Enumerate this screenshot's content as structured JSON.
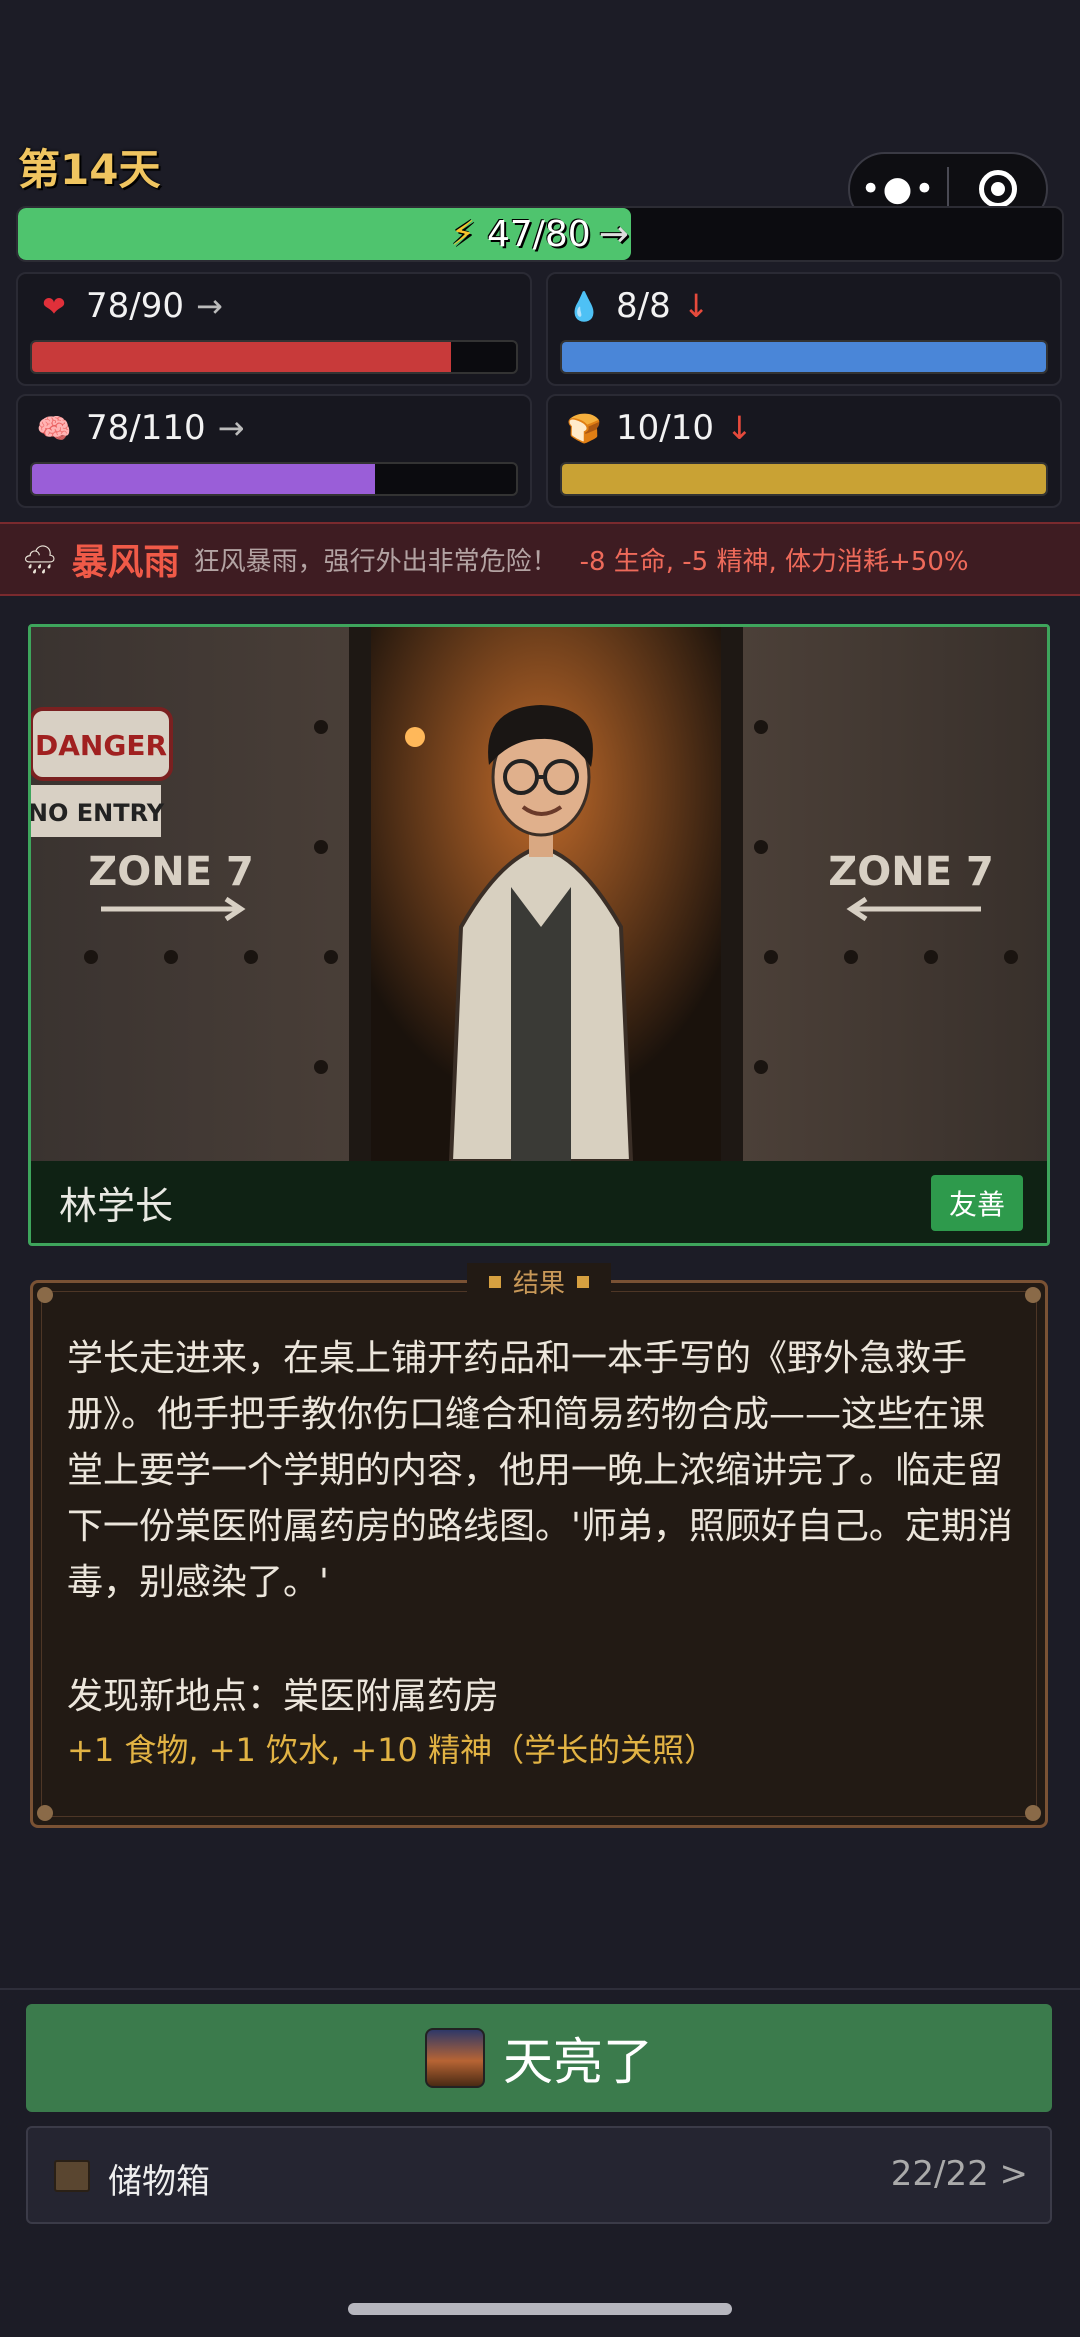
{
  "day_label": "第14天",
  "stamina": {
    "text": "47/80",
    "current": 47,
    "max": 80,
    "trend": "→",
    "icon": "lightning-icon",
    "color": "#4fc46e"
  },
  "stats": [
    {
      "key": "health",
      "icon": "heart-icon",
      "glyph": "❤",
      "text": "78/90",
      "current": 78,
      "max": 90,
      "trend": "→",
      "trend_kind": "steady",
      "color": "#c83a3a"
    },
    {
      "key": "water",
      "icon": "water-drop-icon",
      "glyph": "💧",
      "text": "8/8",
      "current": 8,
      "max": 8,
      "trend": "↓",
      "trend_kind": "down",
      "color": "#4a86d8"
    },
    {
      "key": "spirit",
      "icon": "brain-icon",
      "glyph": "🧠",
      "text": "78/110",
      "current": 78,
      "max": 110,
      "trend": "→",
      "trend_kind": "steady",
      "color": "#9a5ed8"
    },
    {
      "key": "food",
      "icon": "food-icon",
      "glyph": "🍞",
      "text": "10/10",
      "current": 10,
      "max": 10,
      "trend": "↓",
      "trend_kind": "down",
      "color": "#c9a234"
    }
  ],
  "weather": {
    "icon": "storm-icon",
    "name": "暴风雨",
    "description": "狂风暴雨，强行外出非常危险！",
    "effect": "-8 生命, -5 精神, 体力消耗+50%"
  },
  "npc": {
    "name": "林学长",
    "attitude": "友善",
    "scene_signs": [
      "DANGER",
      "NO ENTRY",
      "ZONE 7",
      "ZONE 7"
    ]
  },
  "result": {
    "title": "结果",
    "body": "学长走进来，在桌上铺开药品和一本手写的《野外急救手册》。他手把手教你伤口缝合和简易药物合成——这些在课堂上要学一个学期的内容，他用一晚上浓缩讲完了。临走留下一份棠医附属药房的路线图。'师弟，照顾好自己。定期消毒，别感染了。'",
    "discovery": "发现新地点：棠医附属药房",
    "gains": "+1 食物, +1 饮水, +10 精神（学长的关照）"
  },
  "dawn_button": {
    "label": "天亮了",
    "icon": "sunrise-icon"
  },
  "storage": {
    "label": "储物箱",
    "count": "22/22 >",
    "icon": "chest-icon"
  }
}
